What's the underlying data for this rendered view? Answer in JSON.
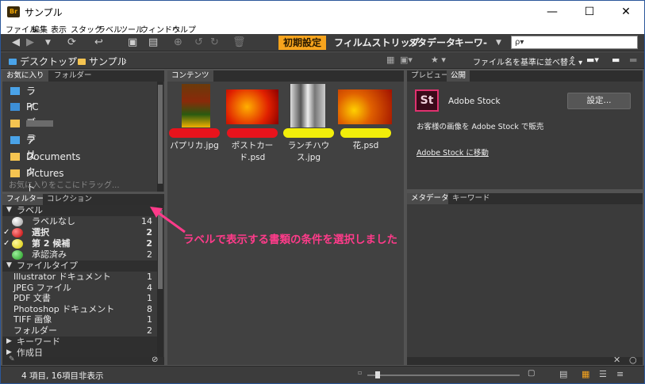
{
  "window": {
    "app_icon_label": "Br",
    "title": "サンプル",
    "minimize": "—",
    "maximize": "☐",
    "close": "✕"
  },
  "menubar": [
    "ファイル",
    "編集",
    "表示",
    "スタック",
    "ラベル",
    "ツール",
    "ウィンドウ",
    "ヘルプ"
  ],
  "toolbar": {
    "workspaces": [
      "初期設定",
      "フィルムストリップ",
      "メタデータ",
      "キーワ-"
    ],
    "search_placeholder": "ρ▾"
  },
  "pathbar": {
    "crumbs": [
      "デスクトップ",
      "サンプル"
    ],
    "sort_label": "ファイル名を基準に並べ替え"
  },
  "favorites_panel": {
    "tabs": [
      "お気に入り",
      "フォルダー"
    ],
    "items": [
      "ライブラリ",
      "PC",
      "",
      "デスクトップ",
      "Documents",
      "Pictures"
    ],
    "drop_hint": "お気に入りをここにドラッグ..."
  },
  "filter_panel": {
    "tabs": [
      "フィルター",
      "コレクション"
    ],
    "label_section": "ラベル",
    "labels": [
      {
        "name": "ラベルなし",
        "count": "14",
        "checked": false
      },
      {
        "name": "選択",
        "count": "2",
        "checked": true
      },
      {
        "name": "第 2 候補",
        "count": "2",
        "checked": true
      },
      {
        "name": "承認済み",
        "count": "2",
        "checked": false
      }
    ],
    "filetype_section": "ファイルタイプ",
    "filetypes": [
      {
        "name": "Illustrator ドキュメント",
        "count": "1"
      },
      {
        "name": "JPEG ファイル",
        "count": "4"
      },
      {
        "name": "PDF 文書",
        "count": "1"
      },
      {
        "name": "Photoshop ドキュメント",
        "count": "8"
      },
      {
        "name": "TIFF 画像",
        "count": "1"
      },
      {
        "name": "フォルダー",
        "count": "2"
      }
    ],
    "keyword_section": "キーワード",
    "date_section": "作成日"
  },
  "content_panel": {
    "tab": "コンテンツ",
    "items": [
      {
        "name": "パプリカ.jpg",
        "label_color": "#e8131c"
      },
      {
        "name": "ポストカード.psd",
        "label_color": "#e8131c"
      },
      {
        "name": "ランチハウス.jpg",
        "label_color": "#f2ee0a"
      },
      {
        "name": "花.psd",
        "label_color": "#f2ee0a"
      }
    ]
  },
  "preview_panel": {
    "tabs": [
      "プレビュー",
      "公開"
    ],
    "stock_icon": "St",
    "stock_name": "Adobe Stock",
    "settings_button": "設定...",
    "sell_text": "お客様の画像を Adobe Stock で販売",
    "go_link": "Adobe Stock に移動"
  },
  "metadata_panel": {
    "tabs": [
      "メタデータ",
      "キーワード"
    ]
  },
  "annotation": "ラベルで表示する書類の条件を選択しました",
  "status": {
    "text": "4 項目, 16項目非表示"
  },
  "colors": {
    "accent": "#f7a41d",
    "annotation": "#ff3b8a",
    "label_red": "#e8131c",
    "label_yellow": "#f2ee0a",
    "label_green": "#2fb82f"
  }
}
